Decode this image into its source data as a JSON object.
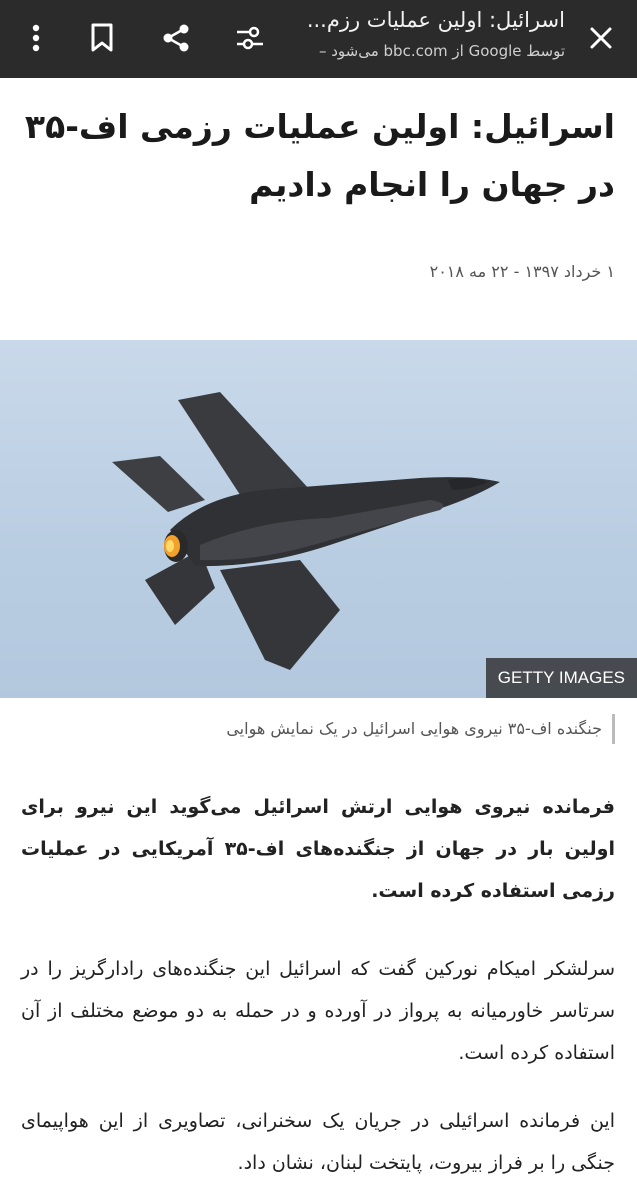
{
  "toolbar": {
    "title": "اسرائیل: اولین عملیات رزم...",
    "subtitle": "توسط Google از bbc.com می‌شود –",
    "icons": [
      "close-icon",
      "tune-icon",
      "share-icon",
      "bookmark-icon",
      "more-vert-icon"
    ]
  },
  "article": {
    "headline": "اسرائیل: اولین عملیات رزمی اف-۳۵ در جهان را انجام دادیم",
    "date": "۱ خرداد ۱۳۹۷ - ۲۲ مه ۲۰۱۸",
    "image_credit": "GETTY IMAGES",
    "caption": "جنگنده اف-۳۵ نیروی هوایی اسرائیل در یک نمایش هوایی",
    "paragraphs": [
      "فرمانده نیروی هوایی ارتش اسرائیل می‌گوید این نیرو برای اولین بار در جهان از جنگنده‌های اف-۳۵ آمریکایی در عملیات رزمی استفاده کرده است.",
      "سرلشکر امیکام نورکین گفت که اسرائیل این جنگنده‌های رادارگریز را در سرتاسر خاورمیانه به پرواز در آورده و در حمله به دو موضع مختلف از آن استفاده کرده است.",
      "این فرمانده اسرائیلی در جریان یک سخنرانی، تصاویری از این هواپیمای جنگی را بر فراز بیروت، پایتخت لبنان، نشان داد."
    ]
  },
  "colors": {
    "toolbar_bg": "#2b2b2b",
    "sky": "#c0d3e7"
  }
}
